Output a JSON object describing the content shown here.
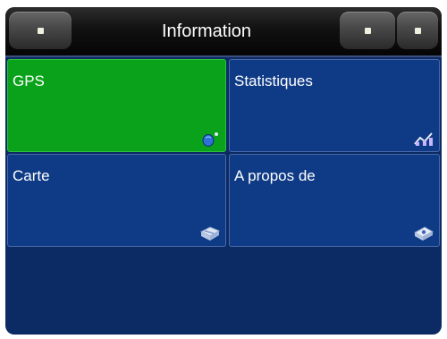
{
  "header": {
    "title": "Information"
  },
  "tiles": [
    {
      "label": "GPS",
      "icon": "satellite-icon",
      "selected": true
    },
    {
      "label": "Statistiques",
      "icon": "chart-icon",
      "selected": false
    },
    {
      "label": "Carte",
      "icon": "map-icon",
      "selected": false
    },
    {
      "label": "A propos de",
      "icon": "info-card-icon",
      "selected": false
    }
  ],
  "colors": {
    "selected": "#0aa21a",
    "tile": "#0f3b86",
    "background": "#0c2a63"
  }
}
